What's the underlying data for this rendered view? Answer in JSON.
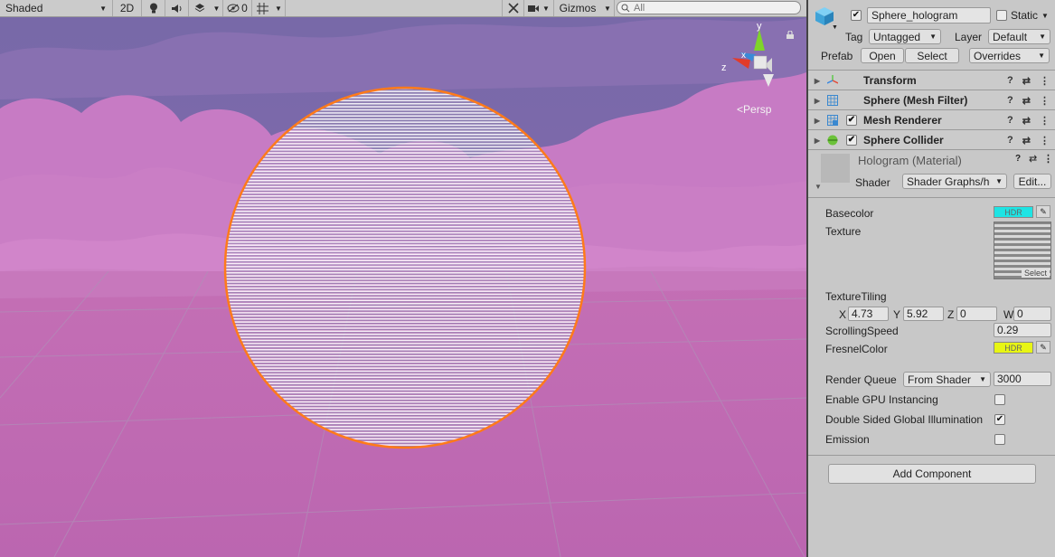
{
  "scene_toolbar": {
    "shading_mode": "Shaded",
    "mode_2d": "2D",
    "hidden_count": "0",
    "gizmos_label": "Gizmos",
    "search_placeholder": "All"
  },
  "scene_view": {
    "projection_label": "Persp",
    "gizmo_axes": {
      "x": "x",
      "y": "y",
      "z": "z"
    },
    "colors": {
      "sky": "#7a6aa8",
      "clouds": "#c77bc4",
      "ground": "#c06fb5",
      "selection_outline": "#ff7a1a"
    }
  },
  "inspector": {
    "object_name": "Sphere_hologram",
    "active": true,
    "static_label": "Static",
    "tag_label": "Tag",
    "tag_value": "Untagged",
    "layer_label": "Layer",
    "layer_value": "Default",
    "prefab_label": "Prefab",
    "prefab_open": "Open",
    "prefab_select": "Select",
    "prefab_overrides": "Overrides",
    "components": [
      {
        "name": "Transform",
        "icon": "transform-icon",
        "has_checkbox": false
      },
      {
        "name": "Sphere (Mesh Filter)",
        "icon": "mesh-filter-icon",
        "has_checkbox": false
      },
      {
        "name": "Mesh Renderer",
        "icon": "mesh-renderer-icon",
        "has_checkbox": true
      },
      {
        "name": "Sphere Collider",
        "icon": "sphere-collider-icon",
        "has_checkbox": true
      }
    ],
    "material": {
      "name": "Hologram (Material)",
      "shader_label": "Shader",
      "shader_value": "Shader Graphs/hc",
      "edit_label": "Edit...",
      "basecolor_label": "Basecolor",
      "basecolor_hdr": "HDR",
      "basecolor_color": "#1ee4e4",
      "texture_label": "Texture",
      "texture_select": "Select",
      "tiling_label": "TextureTiling",
      "tiling": {
        "x_label": "X",
        "x": "4.73",
        "y_label": "Y",
        "y": "5.92",
        "z_label": "Z",
        "z": "0",
        "w_label": "W",
        "w": "0"
      },
      "speed_label": "ScrollingSpeed",
      "speed_value": "0.29",
      "fresnel_label": "FresnelColor",
      "fresnel_hdr": "HDR",
      "fresnel_color": "#e8f514",
      "render_queue_label": "Render Queue",
      "render_queue_mode": "From Shader",
      "render_queue_value": "3000",
      "gpu_instancing_label": "Enable GPU Instancing",
      "gpu_instancing": false,
      "double_sided_gi_label": "Double Sided Global Illumination",
      "double_sided_gi": true,
      "emission_label": "Emission",
      "emission": false
    },
    "add_component_label": "Add Component"
  }
}
